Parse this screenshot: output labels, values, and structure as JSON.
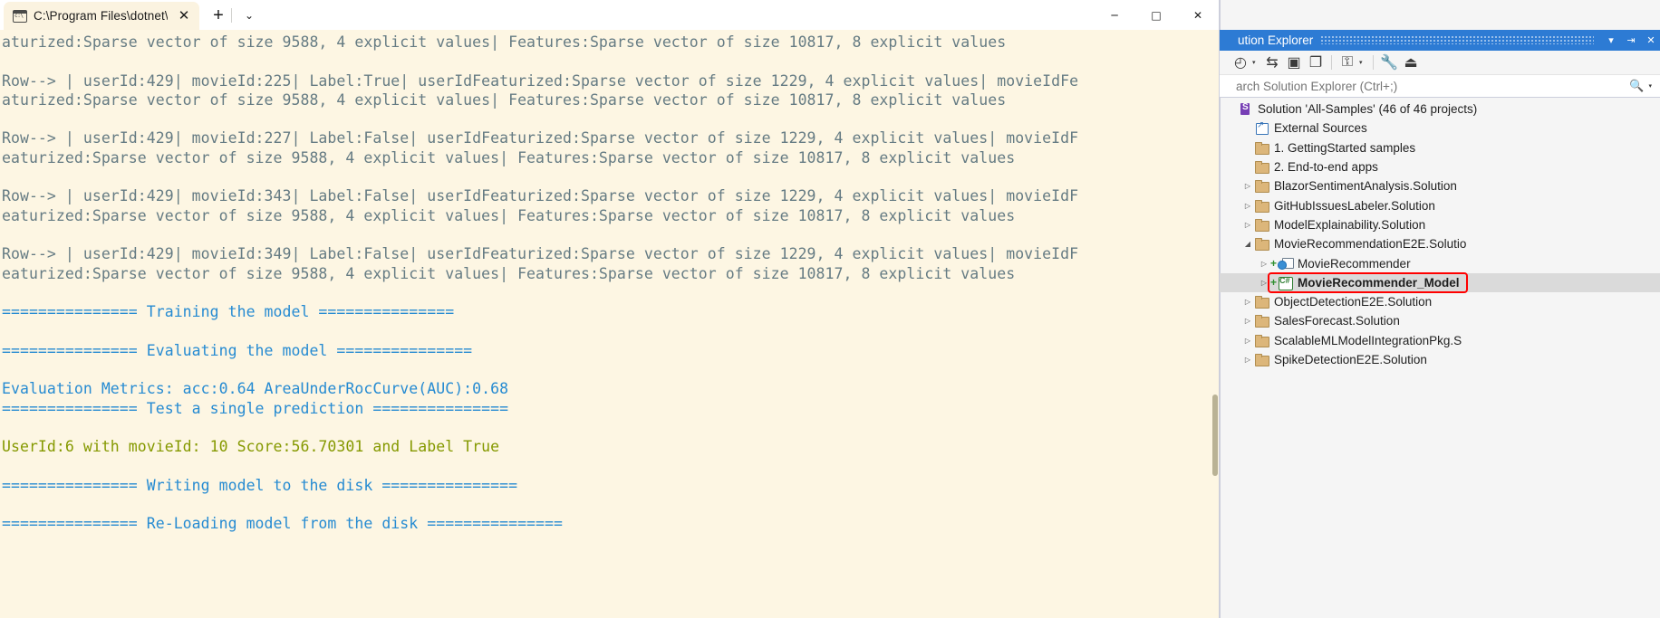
{
  "window": {
    "tab_title": "C:\\Program Files\\dotnet\\d",
    "tab_icon": "console-icon",
    "close_tab_label": "✕",
    "new_tab_label": "+",
    "dropdown_label": "⌄",
    "minimize_label": "─",
    "maximize_label": "□",
    "close_label": "✕"
  },
  "terminal": {
    "lines": [
      {
        "color": "base",
        "text": "aturized:Sparse vector of size 9588, 4 explicit values| Features:Sparse vector of size 10817, 8 explicit values"
      },
      {
        "color": "base",
        "text": ""
      },
      {
        "color": "base",
        "text": "Row--> | userId:429| movieId:225| Label:True| userIdFeaturized:Sparse vector of size 1229, 4 explicit values| movieIdFe"
      },
      {
        "color": "base",
        "text": "aturized:Sparse vector of size 9588, 4 explicit values| Features:Sparse vector of size 10817, 8 explicit values"
      },
      {
        "color": "base",
        "text": ""
      },
      {
        "color": "base",
        "text": "Row--> | userId:429| movieId:227| Label:False| userIdFeaturized:Sparse vector of size 1229, 4 explicit values| movieIdF"
      },
      {
        "color": "base",
        "text": "eaturized:Sparse vector of size 9588, 4 explicit values| Features:Sparse vector of size 10817, 8 explicit values"
      },
      {
        "color": "base",
        "text": ""
      },
      {
        "color": "base",
        "text": "Row--> | userId:429| movieId:343| Label:False| userIdFeaturized:Sparse vector of size 1229, 4 explicit values| movieIdF"
      },
      {
        "color": "base",
        "text": "eaturized:Sparse vector of size 9588, 4 explicit values| Features:Sparse vector of size 10817, 8 explicit values"
      },
      {
        "color": "base",
        "text": ""
      },
      {
        "color": "base",
        "text": "Row--> | userId:429| movieId:349| Label:False| userIdFeaturized:Sparse vector of size 1229, 4 explicit values| movieIdF"
      },
      {
        "color": "base",
        "text": "eaturized:Sparse vector of size 9588, 4 explicit values| Features:Sparse vector of size 10817, 8 explicit values"
      },
      {
        "color": "base",
        "text": ""
      },
      {
        "color": "cyan",
        "text": "=============== Training the model ==============="
      },
      {
        "color": "base",
        "text": ""
      },
      {
        "color": "cyan",
        "text": "=============== Evaluating the model ==============="
      },
      {
        "color": "base",
        "text": ""
      },
      {
        "color": "cyan",
        "text": "Evaluation Metrics: acc:0.64 AreaUnderRocCurve(AUC):0.68"
      },
      {
        "color": "cyan",
        "text": "=============== Test a single prediction ==============="
      },
      {
        "color": "base",
        "text": ""
      },
      {
        "color": "olive",
        "text": "UserId:6 with movieId: 10 Score:56.70301 and Label True"
      },
      {
        "color": "base",
        "text": ""
      },
      {
        "color": "cyan",
        "text": "=============== Writing model to the disk ==============="
      },
      {
        "color": "base",
        "text": ""
      },
      {
        "color": "cyan",
        "text": "=============== Re-Loading model from the disk ==============="
      }
    ],
    "colors": {
      "background": "#fdf6e3",
      "base": "#657b83",
      "cyan": "#268bd2",
      "olive": "#859900"
    }
  },
  "solution_explorer": {
    "title": "ution Explorer",
    "title_buttons": [
      {
        "name": "dropdown-icon",
        "glyph": "▾"
      },
      {
        "name": "pin-icon",
        "glyph": "⇥"
      },
      {
        "name": "close-icon",
        "glyph": "✕"
      }
    ],
    "toolbar": [
      {
        "name": "pending-changes-icon",
        "glyph": "◴",
        "caret": true
      },
      {
        "name": "sync-with-active-document-icon",
        "glyph": "⇆",
        "caret": false
      },
      {
        "name": "collapse-all-icon",
        "glyph": "▣",
        "caret": false
      },
      {
        "name": "show-all-files-icon",
        "glyph": "❐",
        "caret": false
      },
      {
        "name": "view-designer-icon",
        "glyph": "⚿",
        "caret": true
      },
      {
        "name": "properties-icon",
        "glyph": "🔧",
        "caret": false
      },
      {
        "name": "preview-selected-items-icon",
        "glyph": "⏏",
        "caret": false
      }
    ],
    "search": {
      "placeholder": "arch Solution Explorer (Ctrl+;)",
      "value": "",
      "icon": "search-icon",
      "caret": "▾"
    },
    "tree": [
      {
        "indent": 0,
        "twisty": "",
        "icon": "solution",
        "label": "Solution 'All-Samples' (46 of 46 projects)",
        "selected": false,
        "bold": false,
        "plus": false
      },
      {
        "indent": 1,
        "twisty": "",
        "icon": "external",
        "label": "External Sources",
        "selected": false,
        "bold": false,
        "plus": false
      },
      {
        "indent": 1,
        "twisty": "",
        "icon": "folder",
        "label": "1. GettingStarted samples",
        "selected": false,
        "bold": false,
        "plus": false
      },
      {
        "indent": 1,
        "twisty": "",
        "icon": "folder",
        "label": "2. End-to-end apps",
        "selected": false,
        "bold": false,
        "plus": false
      },
      {
        "indent": 1,
        "twisty": "▷",
        "icon": "folder",
        "label": "BlazorSentimentAnalysis.Solution",
        "selected": false,
        "bold": false,
        "plus": false
      },
      {
        "indent": 1,
        "twisty": "▷",
        "icon": "folder",
        "label": "GitHubIssuesLabeler.Solution",
        "selected": false,
        "bold": false,
        "plus": false
      },
      {
        "indent": 1,
        "twisty": "▷",
        "icon": "folder",
        "label": "ModelExplainability.Solution",
        "selected": false,
        "bold": false,
        "plus": false
      },
      {
        "indent": 1,
        "twisty": "◢",
        "icon": "folder",
        "label": "MovieRecommendationE2E.Solutio",
        "selected": false,
        "bold": false,
        "plus": false
      },
      {
        "indent": 2,
        "twisty": "▷",
        "icon": "web",
        "label": "MovieRecommender",
        "selected": false,
        "bold": false,
        "plus": true
      },
      {
        "indent": 2,
        "twisty": "▷",
        "icon": "csharp",
        "label": "MovieRecommender_Model",
        "selected": true,
        "bold": true,
        "plus": true
      },
      {
        "indent": 1,
        "twisty": "▷",
        "icon": "folder",
        "label": "ObjectDetectionE2E.Solution",
        "selected": false,
        "bold": false,
        "plus": false
      },
      {
        "indent": 1,
        "twisty": "▷",
        "icon": "folder",
        "label": "SalesForecast.Solution",
        "selected": false,
        "bold": false,
        "plus": false
      },
      {
        "indent": 1,
        "twisty": "▷",
        "icon": "folder",
        "label": "ScalableMLModelIntegrationPkg.S",
        "selected": false,
        "bold": false,
        "plus": false
      },
      {
        "indent": 1,
        "twisty": "▷",
        "icon": "folder",
        "label": "SpikeDetectionE2E.Solution",
        "selected": false,
        "bold": false,
        "plus": false
      }
    ],
    "highlight_color": "#ff0000",
    "header_color": "#2d7bd4"
  }
}
